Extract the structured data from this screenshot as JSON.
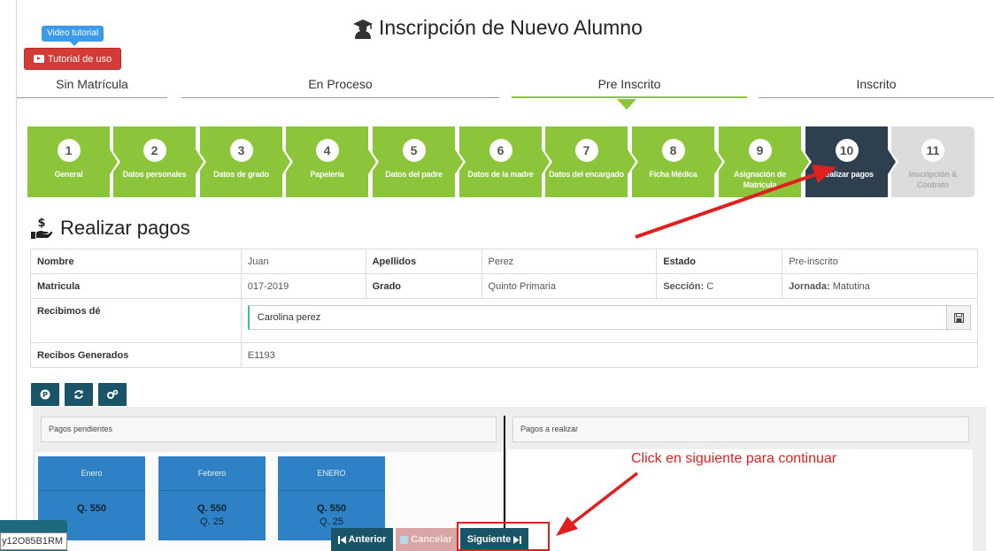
{
  "header": {
    "title": "Inscripción de Nuevo Alumno",
    "video_tip": "Video tutorial",
    "tutorial_button": "Tutorial de uso"
  },
  "status_tabs": [
    {
      "label": "Sin Matrícula",
      "active": false
    },
    {
      "label": "En Proceso",
      "active": false
    },
    {
      "label": "Pre Inscrito",
      "active": true
    },
    {
      "label": "Inscrito",
      "active": false
    }
  ],
  "steps": [
    {
      "num": "1",
      "label": "General",
      "state": "done"
    },
    {
      "num": "2",
      "label": "Datos personales",
      "state": "done"
    },
    {
      "num": "3",
      "label": "Datos de grado",
      "state": "done"
    },
    {
      "num": "4",
      "label": "Papelería",
      "state": "done"
    },
    {
      "num": "5",
      "label": "Datos del padre",
      "state": "done"
    },
    {
      "num": "6",
      "label": "Datos de la madre",
      "state": "done"
    },
    {
      "num": "7",
      "label": "Datos del encargado",
      "state": "done"
    },
    {
      "num": "8",
      "label": "Ficha Médica",
      "state": "done"
    },
    {
      "num": "9",
      "label": "Asignación de Matricula",
      "state": "done"
    },
    {
      "num": "10",
      "label": "Realizar pagos",
      "state": "current"
    },
    {
      "num": "11",
      "label": "Inscripción & Contrato",
      "state": "disabled"
    }
  ],
  "section": {
    "title": "Realizar pagos"
  },
  "info": {
    "nombre_label": "Nombre",
    "nombre": "Juan",
    "apellidos_label": "Apellidos",
    "apellidos": "Perez",
    "estado_label": "Estado",
    "estado": "Pre-inscrito",
    "matricula_label": "Matricula",
    "matricula": "017-2019",
    "grado_label": "Grado",
    "grado": "Quinto Primaria",
    "seccion_label": "Sección:",
    "seccion": "C",
    "jornada_label": "Jornada:",
    "jornada": "Matutina",
    "recibimos_label": "Recibimos dé",
    "recibimos": "Carolina perez",
    "recibos_label": "Recibos Generados",
    "recibos": "E1193"
  },
  "payments": {
    "pending_header": "Pagos pendientes",
    "to_pay_header": "Pagos a realizar",
    "cards": [
      {
        "month": "Enero",
        "amount": "Q. 550",
        "extra": ""
      },
      {
        "month": "Febrero",
        "amount": "Q. 550",
        "extra": "Q. 25"
      },
      {
        "month": "ENERO",
        "amount": "Q. 550",
        "extra": "Q. 25"
      }
    ]
  },
  "nav": {
    "prev": "Anterior",
    "cancel": "Cancelar",
    "next": "Siguiente"
  },
  "annotation": {
    "hint": "Click en siguiente para continuar"
  },
  "tooltip": {
    "text": "y12O85B1RM"
  },
  "colors": {
    "step_done": "#8cc43a",
    "step_current": "#2e4050",
    "primary": "#1a5468",
    "annotation": "#e02020",
    "card": "#2f81c6"
  }
}
